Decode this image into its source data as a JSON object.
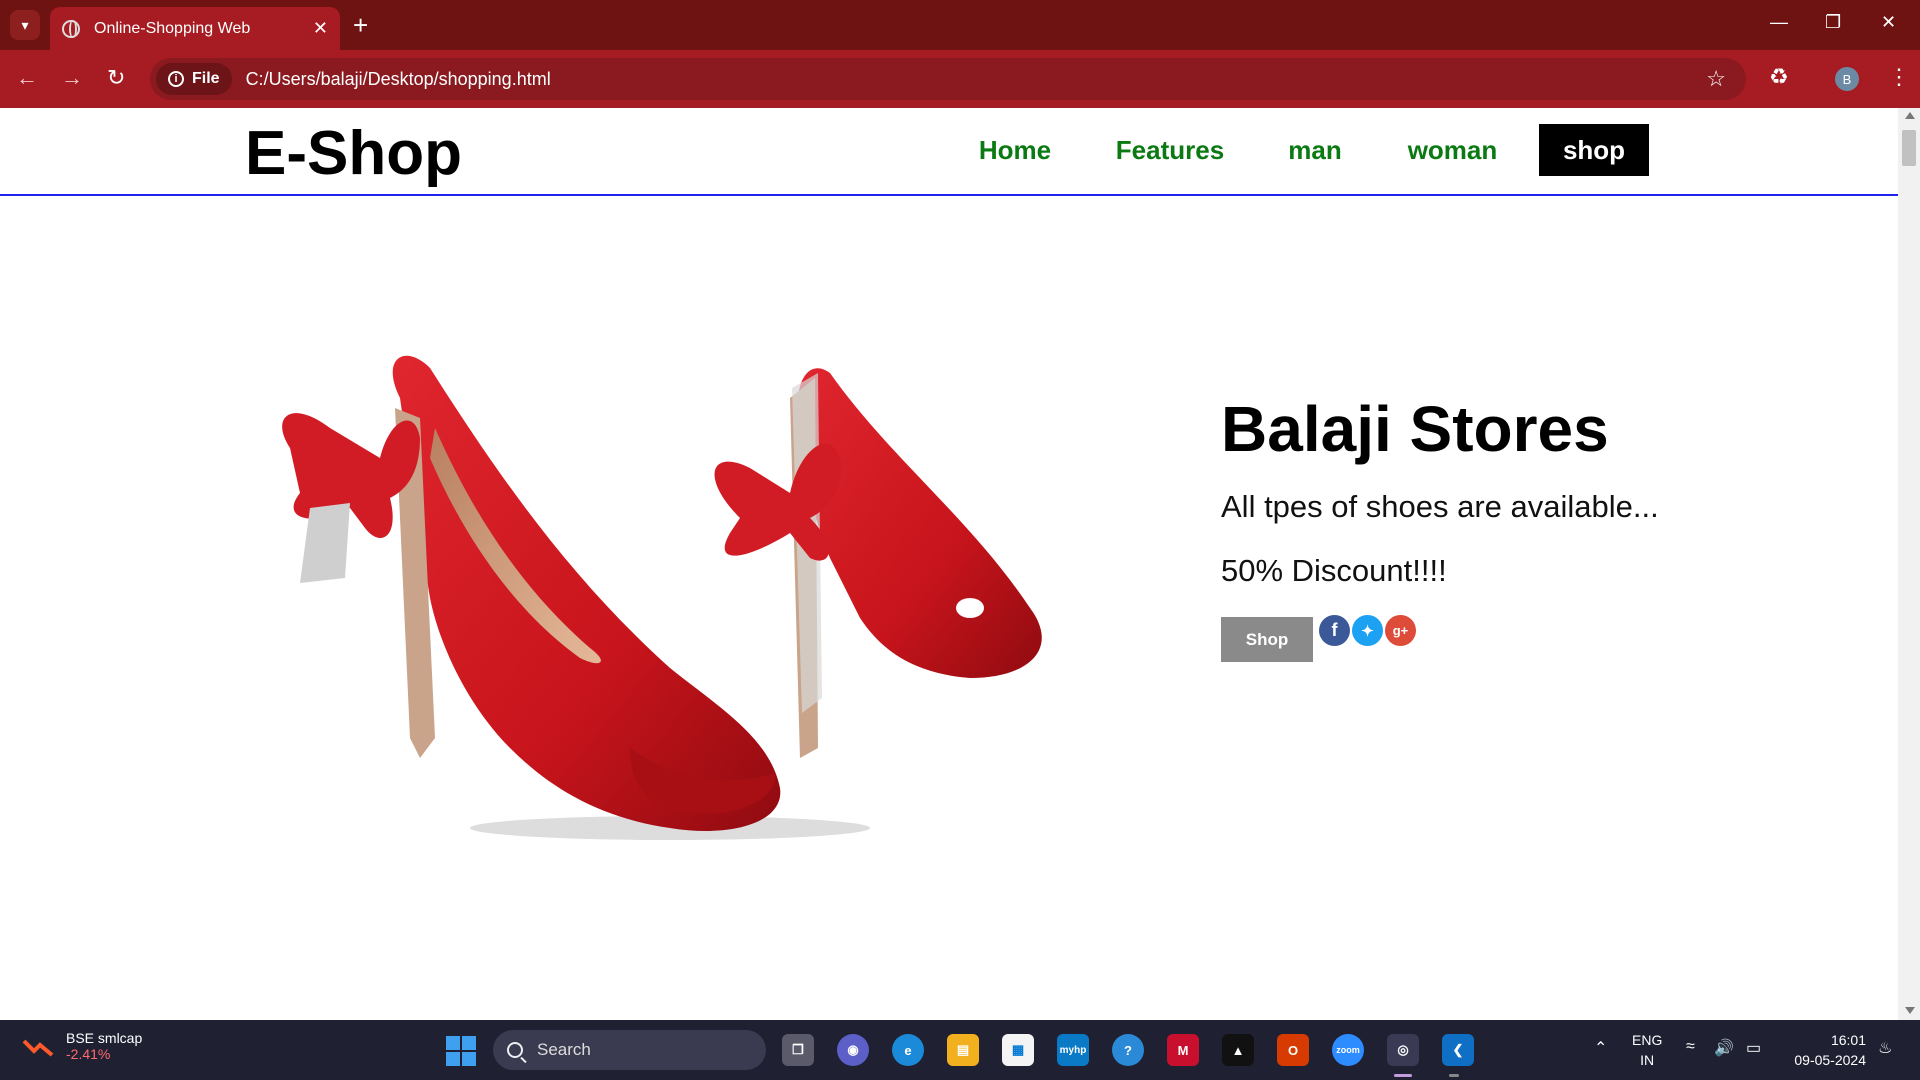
{
  "browser": {
    "tab_title": "Online-Shopping Web",
    "chip_label": "File",
    "url": "C:/Users/balaji/Desktop/shopping.html",
    "profile_initial": "B"
  },
  "site": {
    "logo": "E-Shop",
    "nav": [
      {
        "label": "Home"
      },
      {
        "label": "Features"
      },
      {
        "label": "man"
      },
      {
        "label": "woman"
      },
      {
        "label": "shop"
      }
    ],
    "hero": {
      "title": "Balaji Stores",
      "tagline": "All tpes of shoes are available...",
      "discount": "50% Discount!!!!",
      "button": "Shop",
      "image_alt": "red-high-heel-shoes"
    },
    "colors": {
      "nav_text": "#0b7a13",
      "active_bg": "#000000",
      "button_bg": "#8a8a8a",
      "header_border": "#2222ee"
    }
  },
  "taskbar": {
    "stock_name": "BSE smlcap",
    "stock_change": "-2.41%",
    "search_placeholder": "Search",
    "language": "ENG",
    "region": "IN",
    "time": "16:01",
    "date": "09-05-2024",
    "zoom_label": "zoom",
    "hp_label": "myhp"
  }
}
